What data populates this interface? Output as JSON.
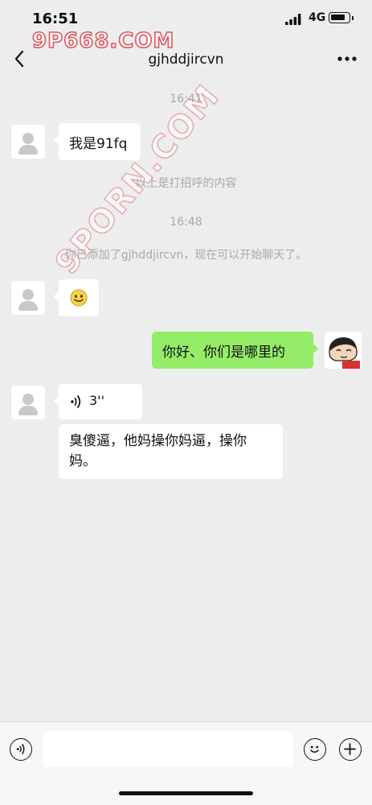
{
  "status_bar": {
    "time": "16:51",
    "network": "4G"
  },
  "header": {
    "title": "gjhddjircvn"
  },
  "watermark": {
    "top": "9P668.COM",
    "diagonal": "9PORN.COM"
  },
  "messages": {
    "ts1": "16:41",
    "m1": "我是91fq",
    "sys1": "以上是打招呼的内容",
    "ts2": "16:48",
    "sys2": "你已添加了gjhddjircvn，现在可以开始聊天了。",
    "m2_emoji": "smiling-face",
    "m3": "你好、你们是哪里的",
    "m4_voice_duration": "3''",
    "m5": "臭傻逼，他妈操你妈逼，操你妈。"
  },
  "input": {
    "placeholder": ""
  },
  "colors": {
    "bubble_out": "#95ec69",
    "bubble_in": "#ffffff",
    "background": "#ededed"
  }
}
